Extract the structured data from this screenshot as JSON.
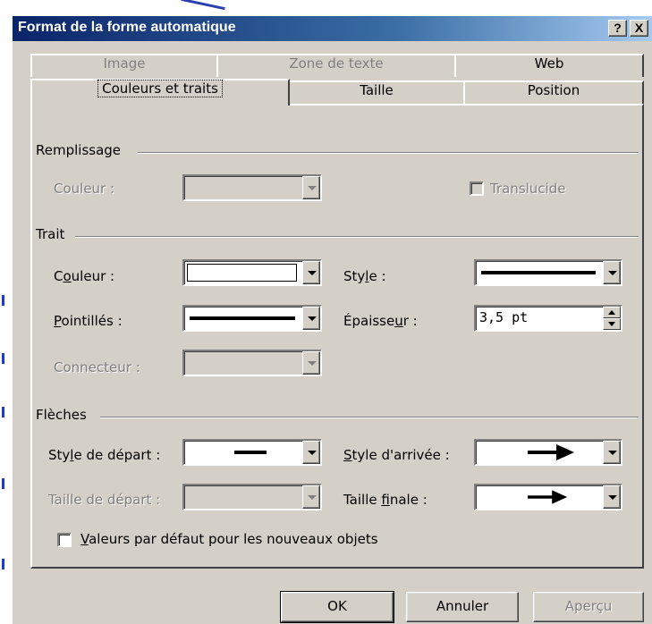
{
  "window": {
    "title": "Format de la forme automatique",
    "help_label": "?",
    "close_label": "X"
  },
  "tabs": {
    "row1": [
      "Image",
      "Zone de texte",
      "Web"
    ],
    "row2": [
      "Couleurs et traits",
      "Taille",
      "Position"
    ],
    "active": "Couleurs et traits"
  },
  "remplissage": {
    "title": "Remplissage",
    "couleur_label": "Couleur :",
    "translucide_label": "Translucide"
  },
  "trait": {
    "title": "Trait",
    "couleur_label_pre": "C",
    "couleur_label_u": "o",
    "couleur_label_post": "uleur :",
    "style_label_pre": "Sty",
    "style_label_u": "l",
    "style_label_post": "e :",
    "pointilles_label_u": "P",
    "pointilles_label_post": "ointillés :",
    "epaisseur_label_pre": "Épaisse",
    "epaisseur_label_u": "u",
    "epaisseur_label_post": "r :",
    "epaisseur_value": "3,5 pt",
    "connecteur_label": "Connecteur :"
  },
  "fleches": {
    "title": "Flèches",
    "style_depart_pre": "Sty",
    "style_depart_u": "l",
    "style_depart_post": "e de départ :",
    "style_arrivee_u": "S",
    "style_arrivee_post": "tyle d'arrivée :",
    "taille_depart_label": "Taille de départ :",
    "taille_finale_pre": "Taille ",
    "taille_finale_u": "f",
    "taille_finale_post": "inale :"
  },
  "defaults_checkbox": {
    "label_u": "V",
    "label_post": "aleurs par défaut pour les nouveaux objets"
  },
  "buttons": {
    "ok": "OK",
    "annuler": "Annuler",
    "apercu": "Aperçu"
  },
  "colors": {
    "title_start": "#0a246a",
    "title_end": "#a6caf0",
    "face": "#d4d0c8",
    "disabled_text": "#808080"
  }
}
